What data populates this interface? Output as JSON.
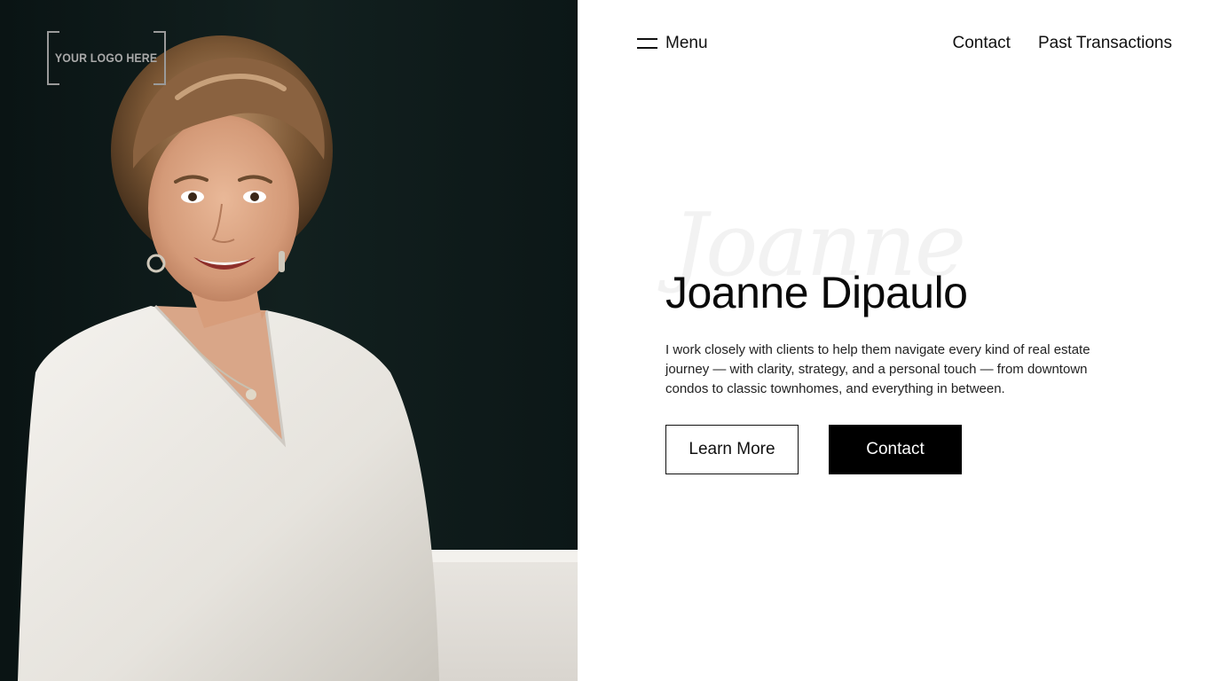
{
  "logo": {
    "text": "YOUR LOGO HERE"
  },
  "photo": {
    "alt": "Portrait of Joanne Dipaulo"
  },
  "header": {
    "menu_label": "Menu",
    "nav": [
      {
        "label": "Contact"
      },
      {
        "label": "Past Transactions"
      }
    ]
  },
  "hero": {
    "script_name": "Joanne",
    "name": "Joanne Dipaulo",
    "bio": "I work closely with clients to help them navigate every kind of real estate journey — with clarity, strategy, and a personal touch — from downtown condos to classic townhomes, and everything in between.",
    "learn_more_label": "Learn More",
    "contact_label": "Contact"
  },
  "colors": {
    "photo_background": "#0f1a1a",
    "text": "#111111",
    "button_solid": "#000000"
  }
}
